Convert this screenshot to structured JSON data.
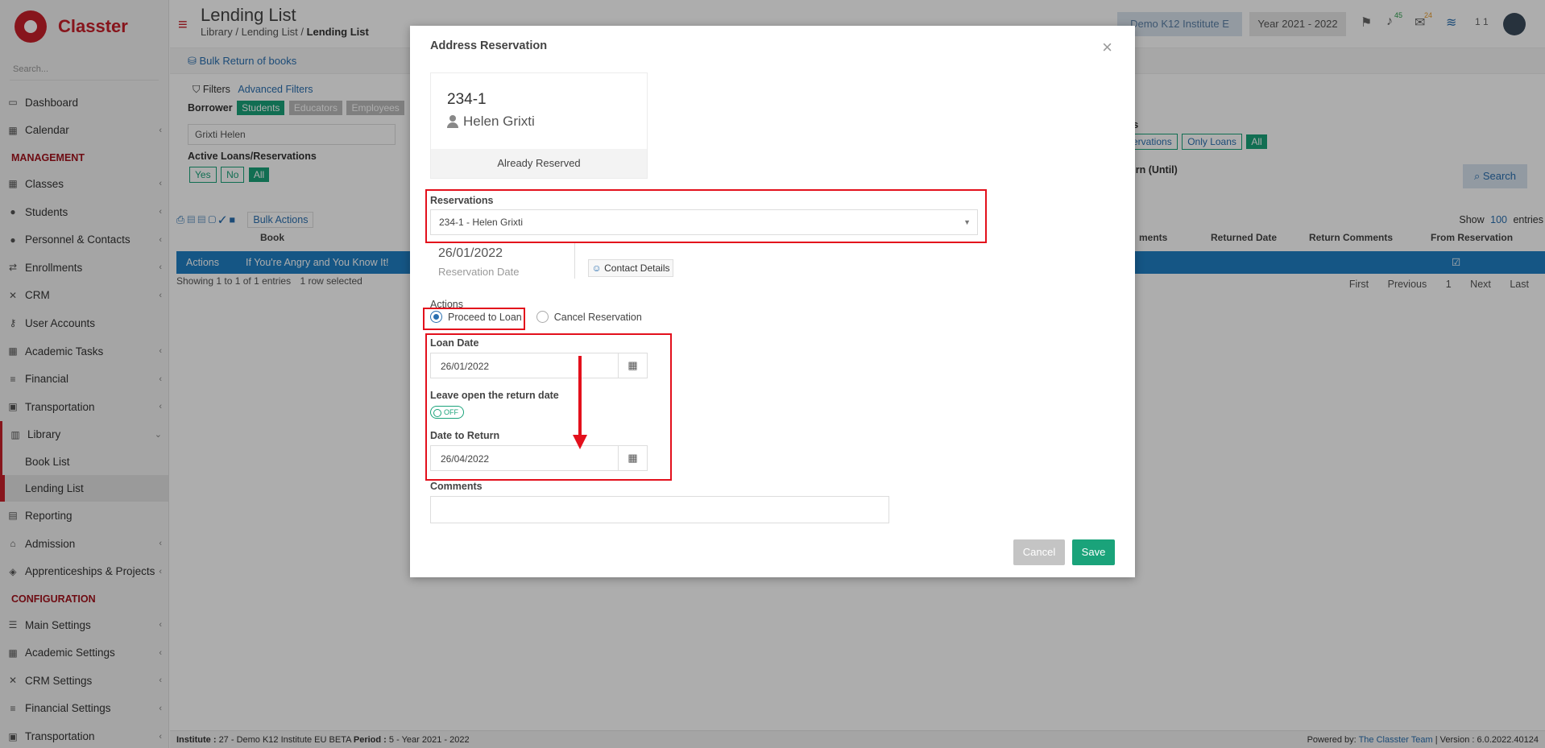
{
  "app": {
    "logo_text": "Classter",
    "search_placeholder": "Search...",
    "page_title": "Lending List",
    "breadcrumb": [
      "Library",
      "Lending List",
      "Lending List"
    ],
    "institute_btn": "Demo K12 Institute E",
    "year_btn": "Year 2021 - 2022",
    "badge_notifications": "45",
    "badge_messages": "24",
    "user_short": "1 1"
  },
  "sidebar": {
    "items": [
      {
        "label": "Dashboard",
        "icon": "monitor-icon"
      },
      {
        "label": "Calendar",
        "icon": "calendar-icon"
      }
    ],
    "section_management": "MANAGEMENT",
    "management_items": [
      {
        "label": "Classes"
      },
      {
        "label": "Students"
      },
      {
        "label": "Personnel & Contacts"
      },
      {
        "label": "Enrollments"
      },
      {
        "label": "CRM"
      },
      {
        "label": "User Accounts"
      },
      {
        "label": "Academic Tasks"
      },
      {
        "label": "Financial"
      },
      {
        "label": "Transportation"
      },
      {
        "label": "Library"
      }
    ],
    "library_sub": [
      "Book List",
      "Lending List"
    ],
    "after_library": [
      {
        "label": "Reporting"
      },
      {
        "label": "Admission"
      },
      {
        "label": "Apprenticeships & Projects"
      }
    ],
    "section_config": "CONFIGURATION",
    "config_items": [
      {
        "label": "Main Settings"
      },
      {
        "label": "Academic Settings"
      },
      {
        "label": "CRM Settings"
      },
      {
        "label": "Financial Settings"
      },
      {
        "label": "Transportation"
      }
    ]
  },
  "background": {
    "bulk_return": "Bulk Return of books",
    "filters": "Filters",
    "advanced_filters": "Advanced Filters",
    "borrower": "Borrower",
    "borrower_tabs": [
      "Students",
      "Educators",
      "Employees"
    ],
    "borrower_value": "Grixti Helen",
    "active_loans": "Active Loans/Reservations",
    "active_opts": [
      "Yes",
      "No",
      "All"
    ],
    "right_label": "ons",
    "right_tags": [
      "servations",
      "Only Loans",
      "All"
    ],
    "return_until": "eturn (Until)",
    "search_btn": "Search",
    "show_entries": "Show",
    "entries_num": "100",
    "entries_word": "entries",
    "bulk_actions": "Bulk Actions",
    "col_book": "Book",
    "col_ments": "ments",
    "col_returned": "Returned Date",
    "col_return_comments": "Return Comments",
    "col_from_res": "From Reservation",
    "row_actions": "Actions",
    "row_book": "If You're Angry and You Know It!",
    "showing": "Showing 1 to 1 of 1 entries",
    "selected": "1 row selected",
    "pager": [
      "First",
      "Previous",
      "1",
      "Next",
      "Last"
    ]
  },
  "footer": {
    "left_institute_label": "Institute :",
    "left_institute": "27 - Demo K12 Institute EU BETA",
    "left_period_label": "Period :",
    "left_period": "5 - Year 2021 - 2022",
    "powered_by": "Powered by:",
    "team": "The Classter Team",
    "version": "| Version : 6.0.2022.40124"
  },
  "modal": {
    "title": "Address Reservation",
    "card_code": "234-1",
    "card_name": "Helen Grixti",
    "card_status": "Already Reserved",
    "reservations_label": "Reservations",
    "reservations_value": "234-1 - Helen Grixti",
    "reservation_date": "26/01/2022",
    "reservation_date_label": "Reservation Date",
    "contact_details": "Contact Details",
    "actions_label": "Actions",
    "action_proceed": "Proceed to Loan",
    "action_cancel": "Cancel Reservation",
    "loan_date_label": "Loan Date",
    "loan_date": "26/01/2022",
    "leave_open_label": "Leave open the return date",
    "toggle_state": "OFF",
    "date_to_return_label": "Date to Return",
    "date_to_return": "26/04/2022",
    "comments_label": "Comments",
    "cancel_btn": "Cancel",
    "save_btn": "Save"
  },
  "colors": {
    "brand": "#c8202a",
    "accent": "#1aa37a",
    "highlight": "#e3101c",
    "row_select": "#1f7fc4"
  }
}
